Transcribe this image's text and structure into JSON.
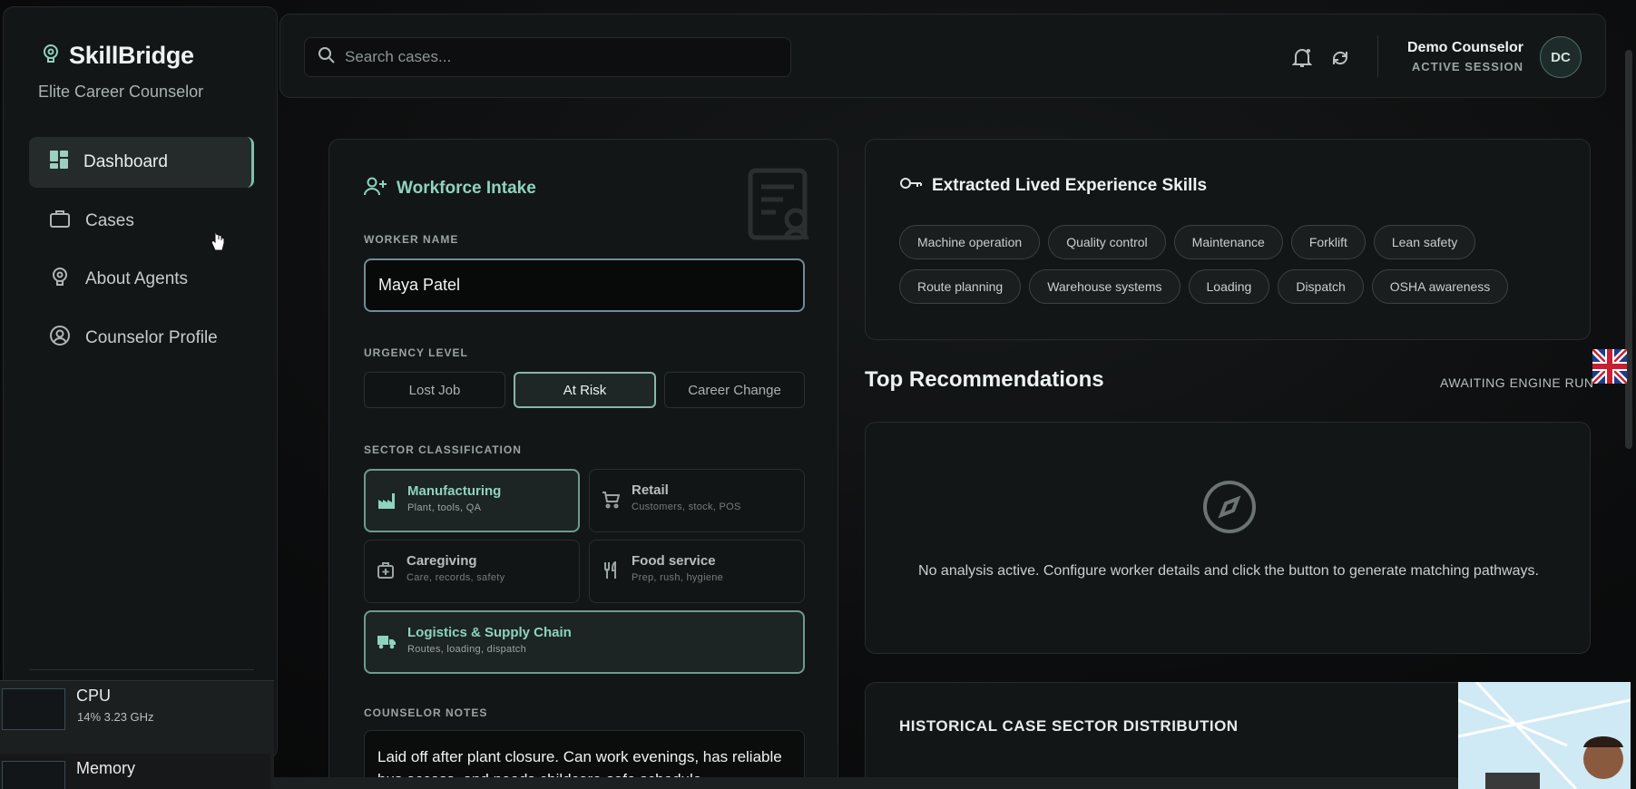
{
  "app": {
    "name": "SkillBridge",
    "subtitle": "Elite Career Counselor"
  },
  "sidebar": {
    "items": [
      {
        "label": "Dashboard",
        "icon": "dashboard-icon",
        "active": true
      },
      {
        "label": "Cases",
        "icon": "briefcase-icon",
        "active": false
      },
      {
        "label": "About Agents",
        "icon": "agents-icon",
        "active": false
      },
      {
        "label": "Counselor Profile",
        "icon": "user-circle-icon",
        "active": false
      }
    ]
  },
  "header": {
    "search_placeholder": "Search cases...",
    "user_name": "Demo Counselor",
    "user_status": "ACTIVE SESSION",
    "avatar_initials": "DC"
  },
  "intake": {
    "title": "Workforce Intake",
    "worker_name_label": "WORKER NAME",
    "worker_name_value": "Maya Patel",
    "urgency_label": "URGENCY LEVEL",
    "urgency_options": [
      "Lost Job",
      "At Risk",
      "Career Change"
    ],
    "urgency_selected": "At Risk",
    "sector_label": "SECTOR CLASSIFICATION",
    "sectors": [
      {
        "title": "Manufacturing",
        "sub": "Plant, tools, QA",
        "icon": "factory-icon",
        "selected": true
      },
      {
        "title": "Retail",
        "sub": "Customers, stock, POS",
        "icon": "cart-icon",
        "selected": false
      },
      {
        "title": "Caregiving",
        "sub": "Care, records, safety",
        "icon": "medical-kit-icon",
        "selected": false
      },
      {
        "title": "Food service",
        "sub": "Prep, rush, hygiene",
        "icon": "utensils-icon",
        "selected": false
      },
      {
        "title": "Logistics & Supply Chain",
        "sub": "Routes, loading, dispatch",
        "icon": "truck-icon",
        "selected": true
      }
    ],
    "notes_label": "COUNSELOR NOTES",
    "notes_value": "Laid off after plant closure. Can work evenings, has reliable bus access, and needs childcare-safe schedule"
  },
  "skills": {
    "title": "Extracted Lived Experience Skills",
    "items": [
      "Machine operation",
      "Quality control",
      "Maintenance",
      "Forklift",
      "Lean safety",
      "Route planning",
      "Warehouse systems",
      "Loading",
      "Dispatch",
      "OSHA awareness"
    ]
  },
  "recommendations": {
    "title": "Top Recommendations",
    "status": "AWAITING ENGINE RUN",
    "empty_text": "No analysis active. Configure worker details and click the button to generate matching pathways."
  },
  "history": {
    "title": "HISTORICAL CASE SECTOR DISTRIBUTION"
  },
  "task_manager": {
    "cpu_label": "CPU",
    "cpu_detail": "14%  3.23 GHz",
    "memory_label": "Memory"
  },
  "colors": {
    "accent": "#8ed3bf",
    "background": "#0a0b0c",
    "card": "#131617"
  }
}
